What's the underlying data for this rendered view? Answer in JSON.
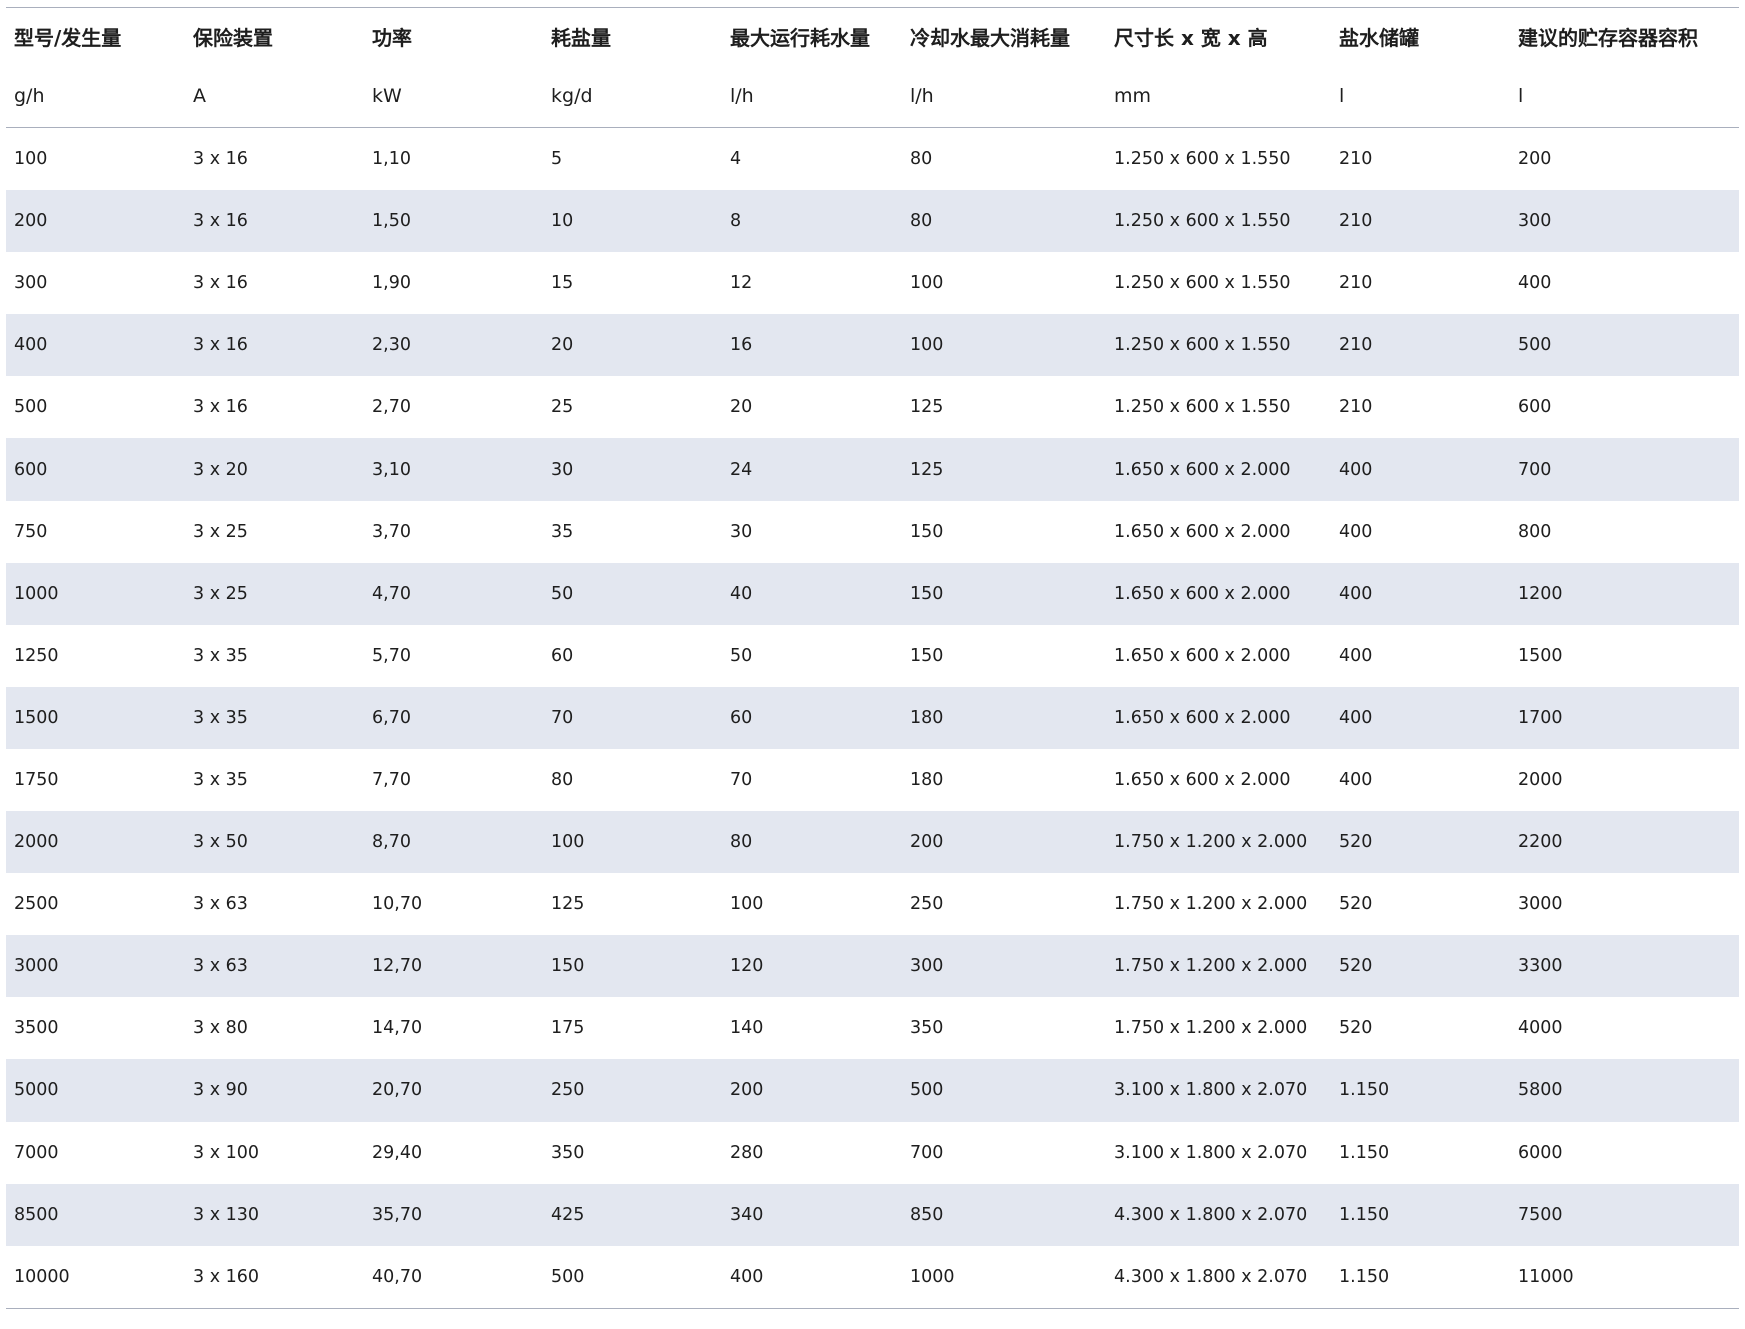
{
  "table": {
    "columns": [
      {
        "label": "型号/发生量",
        "unit": "g/h"
      },
      {
        "label": "保险装置",
        "unit": "A"
      },
      {
        "label": "功率",
        "unit": "kW"
      },
      {
        "label": "耗盐量",
        "unit": "kg/d"
      },
      {
        "label": "最大运行耗水量",
        "unit": "l/h"
      },
      {
        "label": "冷却水最大消耗量",
        "unit": "l/h"
      },
      {
        "label": "尺寸长 x 宽 x 高",
        "unit": "mm"
      },
      {
        "label": "盐水储罐",
        "unit": "l"
      },
      {
        "label": "建议的贮存容器容积",
        "unit": "l"
      }
    ],
    "rows": [
      [
        "100",
        "3 x 16",
        "1,10",
        "5",
        "4",
        "80",
        "1.250 x 600 x 1.550",
        "210",
        "200"
      ],
      [
        "200",
        "3 x 16",
        "1,50",
        "10",
        "8",
        "80",
        "1.250 x 600 x 1.550",
        "210",
        "300"
      ],
      [
        "300",
        "3 x 16",
        "1,90",
        "15",
        "12",
        "100",
        "1.250 x 600 x 1.550",
        "210",
        "400"
      ],
      [
        "400",
        "3 x 16",
        "2,30",
        "20",
        "16",
        "100",
        "1.250 x 600 x 1.550",
        "210",
        "500"
      ],
      [
        "500",
        "3 x 16",
        "2,70",
        "25",
        "20",
        "125",
        "1.250 x 600 x 1.550",
        "210",
        "600"
      ],
      [
        "600",
        "3 x 20",
        "3,10",
        "30",
        "24",
        "125",
        "1.650 x 600 x 2.000",
        "400",
        "700"
      ],
      [
        "750",
        "3 x 25",
        "3,70",
        "35",
        "30",
        "150",
        "1.650 x 600 x 2.000",
        "400",
        "800"
      ],
      [
        "1000",
        "3 x 25",
        "4,70",
        "50",
        "40",
        "150",
        "1.650 x 600 x 2.000",
        "400",
        "1200"
      ],
      [
        "1250",
        "3 x 35",
        "5,70",
        "60",
        "50",
        "150",
        "1.650 x 600 x 2.000",
        "400",
        "1500"
      ],
      [
        "1500",
        "3 x 35",
        "6,70",
        "70",
        "60",
        "180",
        "1.650 x 600 x 2.000",
        "400",
        "1700"
      ],
      [
        "1750",
        "3 x 35",
        "7,70",
        "80",
        "70",
        "180",
        "1.650 x 600 x 2.000",
        "400",
        "2000"
      ],
      [
        "2000",
        "3 x 50",
        "8,70",
        "100",
        "80",
        "200",
        "1.750 x 1.200 x 2.000",
        "520",
        "2200"
      ],
      [
        "2500",
        "3 x 63",
        "10,70",
        "125",
        "100",
        "250",
        "1.750 x 1.200 x 2.000",
        "520",
        "3000"
      ],
      [
        "3000",
        "3 x 63",
        "12,70",
        "150",
        "120",
        "300",
        "1.750 x 1.200 x 2.000",
        "520",
        "3300"
      ],
      [
        "3500",
        "3 x 80",
        "14,70",
        "175",
        "140",
        "350",
        "1.750 x 1.200 x 2.000",
        "520",
        "4000"
      ],
      [
        "5000",
        "3 x 90",
        "20,70",
        "250",
        "200",
        "500",
        "3.100 x 1.800 x 2.070",
        "1.150",
        "5800"
      ],
      [
        "7000",
        "3 x 100",
        "29,40",
        "350",
        "280",
        "700",
        "3.100 x 1.800 x 2.070",
        "1.150",
        "6000"
      ],
      [
        "8500",
        "3 x 130",
        "35,70",
        "425",
        "340",
        "850",
        "4.300 x 1.800 x 2.070",
        "1.150",
        "7500"
      ],
      [
        "10000",
        "3 x 160",
        "40,70",
        "500",
        "400",
        "1000",
        "4.300 x 1.800 x 2.070",
        "1.150",
        "11000"
      ]
    ]
  },
  "colors": {
    "stripe": "#e3e7f0",
    "rule": "#a9afbd",
    "text": "#1e1e1e"
  }
}
